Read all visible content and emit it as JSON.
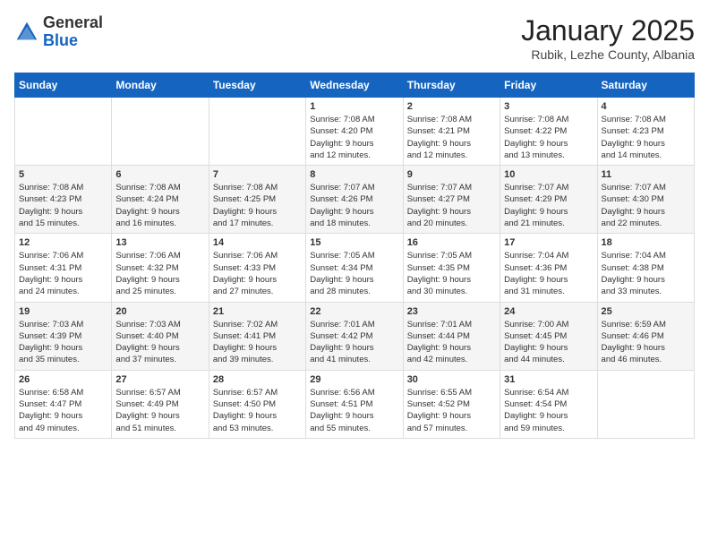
{
  "header": {
    "logo_general": "General",
    "logo_blue": "Blue",
    "month_title": "January 2025",
    "location": "Rubik, Lezhe County, Albania"
  },
  "days_of_week": [
    "Sunday",
    "Monday",
    "Tuesday",
    "Wednesday",
    "Thursday",
    "Friday",
    "Saturday"
  ],
  "weeks": [
    [
      {
        "day": "",
        "info": ""
      },
      {
        "day": "",
        "info": ""
      },
      {
        "day": "",
        "info": ""
      },
      {
        "day": "1",
        "info": "Sunrise: 7:08 AM\nSunset: 4:20 PM\nDaylight: 9 hours\nand 12 minutes."
      },
      {
        "day": "2",
        "info": "Sunrise: 7:08 AM\nSunset: 4:21 PM\nDaylight: 9 hours\nand 12 minutes."
      },
      {
        "day": "3",
        "info": "Sunrise: 7:08 AM\nSunset: 4:22 PM\nDaylight: 9 hours\nand 13 minutes."
      },
      {
        "day": "4",
        "info": "Sunrise: 7:08 AM\nSunset: 4:23 PM\nDaylight: 9 hours\nand 14 minutes."
      }
    ],
    [
      {
        "day": "5",
        "info": "Sunrise: 7:08 AM\nSunset: 4:23 PM\nDaylight: 9 hours\nand 15 minutes."
      },
      {
        "day": "6",
        "info": "Sunrise: 7:08 AM\nSunset: 4:24 PM\nDaylight: 9 hours\nand 16 minutes."
      },
      {
        "day": "7",
        "info": "Sunrise: 7:08 AM\nSunset: 4:25 PM\nDaylight: 9 hours\nand 17 minutes."
      },
      {
        "day": "8",
        "info": "Sunrise: 7:07 AM\nSunset: 4:26 PM\nDaylight: 9 hours\nand 18 minutes."
      },
      {
        "day": "9",
        "info": "Sunrise: 7:07 AM\nSunset: 4:27 PM\nDaylight: 9 hours\nand 20 minutes."
      },
      {
        "day": "10",
        "info": "Sunrise: 7:07 AM\nSunset: 4:29 PM\nDaylight: 9 hours\nand 21 minutes."
      },
      {
        "day": "11",
        "info": "Sunrise: 7:07 AM\nSunset: 4:30 PM\nDaylight: 9 hours\nand 22 minutes."
      }
    ],
    [
      {
        "day": "12",
        "info": "Sunrise: 7:06 AM\nSunset: 4:31 PM\nDaylight: 9 hours\nand 24 minutes."
      },
      {
        "day": "13",
        "info": "Sunrise: 7:06 AM\nSunset: 4:32 PM\nDaylight: 9 hours\nand 25 minutes."
      },
      {
        "day": "14",
        "info": "Sunrise: 7:06 AM\nSunset: 4:33 PM\nDaylight: 9 hours\nand 27 minutes."
      },
      {
        "day": "15",
        "info": "Sunrise: 7:05 AM\nSunset: 4:34 PM\nDaylight: 9 hours\nand 28 minutes."
      },
      {
        "day": "16",
        "info": "Sunrise: 7:05 AM\nSunset: 4:35 PM\nDaylight: 9 hours\nand 30 minutes."
      },
      {
        "day": "17",
        "info": "Sunrise: 7:04 AM\nSunset: 4:36 PM\nDaylight: 9 hours\nand 31 minutes."
      },
      {
        "day": "18",
        "info": "Sunrise: 7:04 AM\nSunset: 4:38 PM\nDaylight: 9 hours\nand 33 minutes."
      }
    ],
    [
      {
        "day": "19",
        "info": "Sunrise: 7:03 AM\nSunset: 4:39 PM\nDaylight: 9 hours\nand 35 minutes."
      },
      {
        "day": "20",
        "info": "Sunrise: 7:03 AM\nSunset: 4:40 PM\nDaylight: 9 hours\nand 37 minutes."
      },
      {
        "day": "21",
        "info": "Sunrise: 7:02 AM\nSunset: 4:41 PM\nDaylight: 9 hours\nand 39 minutes."
      },
      {
        "day": "22",
        "info": "Sunrise: 7:01 AM\nSunset: 4:42 PM\nDaylight: 9 hours\nand 41 minutes."
      },
      {
        "day": "23",
        "info": "Sunrise: 7:01 AM\nSunset: 4:44 PM\nDaylight: 9 hours\nand 42 minutes."
      },
      {
        "day": "24",
        "info": "Sunrise: 7:00 AM\nSunset: 4:45 PM\nDaylight: 9 hours\nand 44 minutes."
      },
      {
        "day": "25",
        "info": "Sunrise: 6:59 AM\nSunset: 4:46 PM\nDaylight: 9 hours\nand 46 minutes."
      }
    ],
    [
      {
        "day": "26",
        "info": "Sunrise: 6:58 AM\nSunset: 4:47 PM\nDaylight: 9 hours\nand 49 minutes."
      },
      {
        "day": "27",
        "info": "Sunrise: 6:57 AM\nSunset: 4:49 PM\nDaylight: 9 hours\nand 51 minutes."
      },
      {
        "day": "28",
        "info": "Sunrise: 6:57 AM\nSunset: 4:50 PM\nDaylight: 9 hours\nand 53 minutes."
      },
      {
        "day": "29",
        "info": "Sunrise: 6:56 AM\nSunset: 4:51 PM\nDaylight: 9 hours\nand 55 minutes."
      },
      {
        "day": "30",
        "info": "Sunrise: 6:55 AM\nSunset: 4:52 PM\nDaylight: 9 hours\nand 57 minutes."
      },
      {
        "day": "31",
        "info": "Sunrise: 6:54 AM\nSunset: 4:54 PM\nDaylight: 9 hours\nand 59 minutes."
      },
      {
        "day": "",
        "info": ""
      }
    ]
  ]
}
